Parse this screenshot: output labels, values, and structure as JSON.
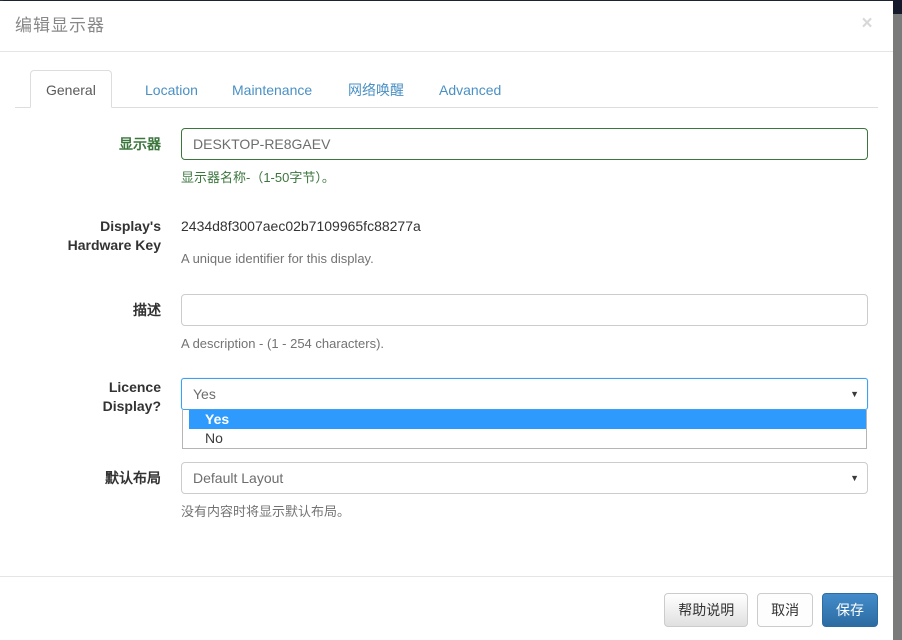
{
  "window": {
    "title": "编辑显示器",
    "close_icon": "close-icon",
    "close_label": "×"
  },
  "tabs": [
    {
      "label": "General",
      "active": true
    },
    {
      "label": "Location",
      "active": false
    },
    {
      "label": "Maintenance",
      "active": false
    },
    {
      "label": "网络唤醒",
      "active": false
    },
    {
      "label": "Advanced",
      "active": false
    }
  ],
  "form": {
    "display_name": {
      "label": "显示器",
      "value": "DESKTOP-RE8GAEV",
      "placeholder": "",
      "help": "显示器名称-（1-50字节）。",
      "state_color": "#3c763d"
    },
    "hardware_key": {
      "label": "Display's Hardware Key",
      "label_line1": "Display's",
      "label_line2": "Hardware Key",
      "value": "2434d8f3007aec02b7109965fc88277a",
      "help": "A unique identifier for this display."
    },
    "description": {
      "label": "描述",
      "value": "",
      "placeholder": "",
      "help": "A description - (1 - 254 characters)."
    },
    "licence_display": {
      "label": "Licence Display?",
      "label_line1": "Licence",
      "label_line2": "Display?",
      "value": "Yes",
      "open": true,
      "caret_icon": "chevron-down-icon",
      "caret_glyph": "▼",
      "options": [
        {
          "label": "Yes",
          "selected": true
        },
        {
          "label": "No",
          "selected": false
        }
      ],
      "highlight_color": "#2e9afe"
    },
    "default_layout": {
      "label": "默认布局",
      "value": "Default Layout",
      "caret_icon": "chevron-down-icon",
      "caret_glyph": "▼",
      "help": "没有内容时将显示默认布局。"
    }
  },
  "footer": {
    "help_label": "帮助说明",
    "cancel_label": "取消",
    "save_label": "保存",
    "save_color": "#3276b1"
  }
}
